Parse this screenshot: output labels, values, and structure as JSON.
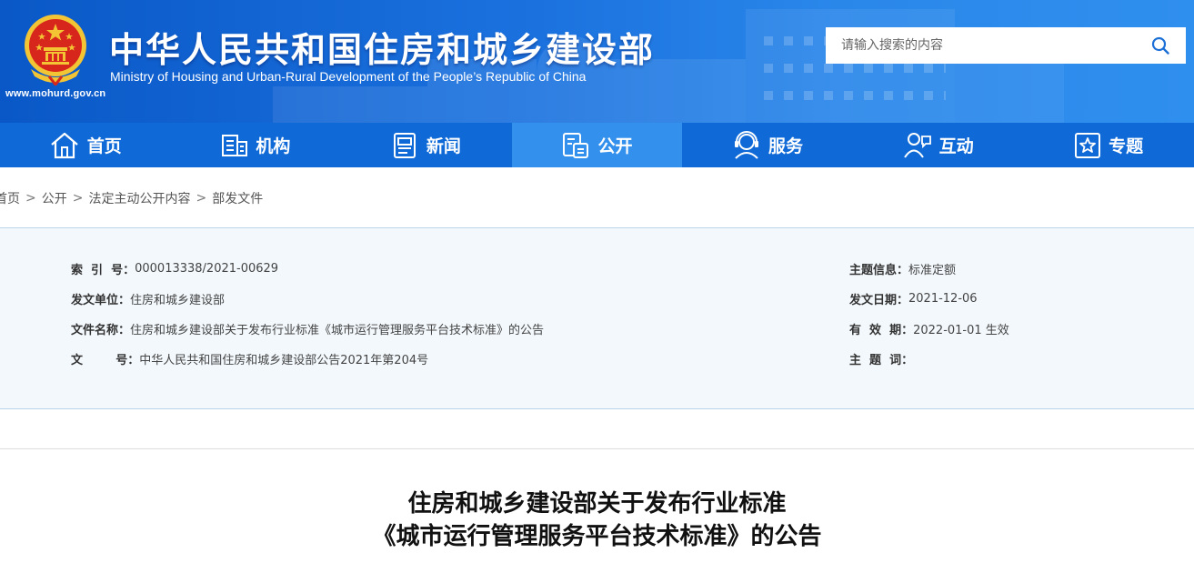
{
  "header": {
    "title": "中华人民共和国住房和城乡建设部",
    "subtitle": "Ministry of Housing and Urban-Rural Development of the People’s Republic of China",
    "url": "www.mohurd.gov.cn",
    "search": {
      "placeholder": "请输入搜索的内容",
      "value": ""
    },
    "colors": {
      "header_bg": "#1b72df",
      "nav_bg": "#0f6ad8",
      "nav_active": "#3390ec",
      "emblem_red": "#d7261b",
      "emblem_gold": "#f3c534"
    }
  },
  "nav": {
    "items": [
      {
        "label": "首页",
        "icon": "home-icon"
      },
      {
        "label": "机构",
        "icon": "building-icon"
      },
      {
        "label": "新闻",
        "icon": "news-icon"
      },
      {
        "label": "公开",
        "icon": "document-icon",
        "active": true
      },
      {
        "label": "服务",
        "icon": "service-icon"
      },
      {
        "label": "互动",
        "icon": "interaction-icon"
      },
      {
        "label": "专题",
        "icon": "star-icon"
      }
    ]
  },
  "breadcrumb": {
    "items": [
      "首页",
      "公开",
      "法定主动公开内容",
      "部发文件"
    ],
    "separator": ">"
  },
  "info": {
    "index_label": "索  引  号：",
    "index_value": "000013338/2021-00629",
    "unit_label": "发文单位：",
    "unit_value": "住房和城乡建设部",
    "name_label": "文件名称：",
    "name_value": "住房和城乡建设部关于发布行业标准《城市运行管理服务平台技术标准》的公告",
    "number_label": "文        号：",
    "number_value": "中华人民共和国住房和城乡建设部公告2021年第204号",
    "topic_info_label": "主题信息：",
    "topic_info_value": "标准定额",
    "date_label": "发文日期：",
    "date_value": "2021-12-06",
    "validity_label": "有  效  期：",
    "validity_value": "2022-01-01 生效",
    "keywords_label": "主  题  词：",
    "keywords_value": ""
  },
  "article": {
    "title_line1": "住房和城乡建设部关于发布行业标准",
    "title_line2": "《城市运行管理服务平台技术标准》的公告"
  }
}
